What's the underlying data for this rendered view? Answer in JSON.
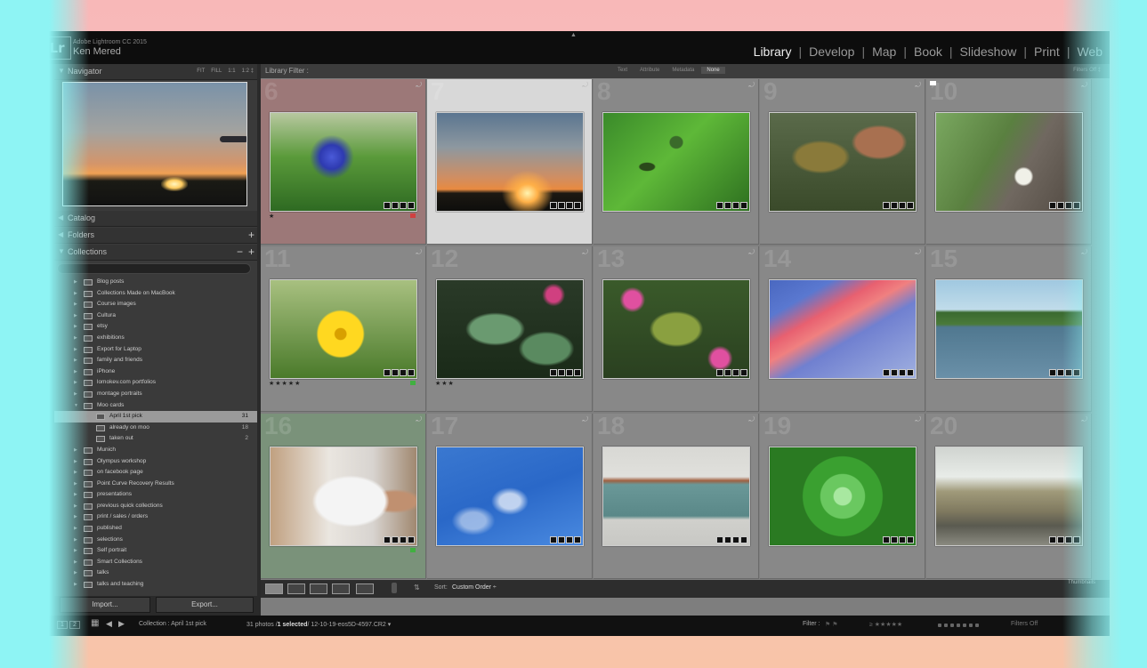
{
  "app": {
    "name": "Adobe Lightroom CC 2015",
    "user": "Ken Mered",
    "logo": "Lr"
  },
  "modules": [
    "Library",
    "Develop",
    "Map",
    "Book",
    "Slideshow",
    "Print",
    "Web"
  ],
  "active_module": "Library",
  "left_panel": {
    "navigator": {
      "title": "Navigator",
      "zooms": [
        "FIT",
        "FILL",
        "1:1",
        "1:2 ‡"
      ]
    },
    "catalog": "Catalog",
    "folders": "Folders",
    "collections_title": "Collections",
    "collections": [
      {
        "name": "Blog posts",
        "count": ""
      },
      {
        "name": "Collections Made on MacBook",
        "count": ""
      },
      {
        "name": "Course images",
        "count": ""
      },
      {
        "name": "Cultura",
        "count": ""
      },
      {
        "name": "etsy",
        "count": ""
      },
      {
        "name": "exhibitions",
        "count": ""
      },
      {
        "name": "Export for Laptop",
        "count": ""
      },
      {
        "name": "family and friends",
        "count": ""
      },
      {
        "name": "iPhone",
        "count": ""
      },
      {
        "name": "lomokev.com portfolios",
        "count": ""
      },
      {
        "name": "montage portraits",
        "count": ""
      },
      {
        "name": "Moo cards",
        "count": ""
      },
      {
        "name": "April 1st pick",
        "count": "31"
      },
      {
        "name": "already on moo",
        "count": "18"
      },
      {
        "name": "taken out",
        "count": "2"
      },
      {
        "name": "Munich",
        "count": ""
      },
      {
        "name": "Olympus workshop",
        "count": ""
      },
      {
        "name": "on facebook page",
        "count": ""
      },
      {
        "name": "Point Curve Recovery Results",
        "count": ""
      },
      {
        "name": "presentations",
        "count": ""
      },
      {
        "name": "previous quick collections",
        "count": ""
      },
      {
        "name": "print / sales / orders",
        "count": ""
      },
      {
        "name": "published",
        "count": ""
      },
      {
        "name": "selections",
        "count": ""
      },
      {
        "name": "Self portrait",
        "count": ""
      },
      {
        "name": "Smart Collections",
        "count": ""
      },
      {
        "name": "talks",
        "count": ""
      },
      {
        "name": "talks and teaching",
        "count": ""
      }
    ],
    "import_label": "Import...",
    "export_label": "Export..."
  },
  "filter_bar": {
    "label": "Library Filter :",
    "tabs": [
      "Text",
      "Attribute",
      "Metadata",
      "None"
    ],
    "active": "None",
    "filters_off": "Filters Off ‡"
  },
  "grid": [
    {
      "num": "6",
      "stars": "★",
      "color_label": "#d04040",
      "bg": "#9c7878",
      "icon": "cornflower-photo"
    },
    {
      "num": "7",
      "stars": "",
      "color_label": "",
      "bg": "#d8d8d8",
      "icon": "sunset-photo"
    },
    {
      "num": "8",
      "stars": "",
      "color_label": "",
      "bg": "#888888",
      "icon": "leaf-photo"
    },
    {
      "num": "9",
      "stars": "",
      "color_label": "",
      "bg": "#888888",
      "icon": "rose-leaves-photo"
    },
    {
      "num": "10",
      "stars": "",
      "color_label": "",
      "bg": "#888888",
      "icon": "snail-photo"
    },
    {
      "num": "11",
      "stars": "★★★★★",
      "color_label": "#40b040",
      "bg": "#888888",
      "icon": "daisy-photo"
    },
    {
      "num": "12",
      "stars": "★★★",
      "color_label": "",
      "bg": "#888888",
      "icon": "wet-leaves-photo"
    },
    {
      "num": "13",
      "stars": "",
      "color_label": "",
      "bg": "#888888",
      "icon": "buds-photo"
    },
    {
      "num": "14",
      "stars": "",
      "color_label": "",
      "bg": "#888888",
      "icon": "pink-sky-photo"
    },
    {
      "num": "15",
      "stars": "",
      "color_label": "",
      "bg": "#888888",
      "icon": "lake-photo"
    },
    {
      "num": "16",
      "stars": "",
      "color_label": "#40b040",
      "bg": "#7a927a",
      "icon": "pregnancy-photo"
    },
    {
      "num": "17",
      "stars": "",
      "color_label": "",
      "bg": "#888888",
      "icon": "blue-sky-photo"
    },
    {
      "num": "18",
      "stars": "",
      "color_label": "",
      "bg": "#888888",
      "icon": "tin-photo"
    },
    {
      "num": "19",
      "stars": "",
      "color_label": "",
      "bg": "#888888",
      "icon": "succulent-photo"
    },
    {
      "num": "20",
      "stars": "",
      "color_label": "",
      "bg": "#888888",
      "icon": "sofa-photo"
    }
  ],
  "toolbar": {
    "sort_label": "Sort:",
    "sort_value": "Custom Order ÷",
    "thumbnails": "Thumbnails"
  },
  "bottom_bar": {
    "pages": [
      "1",
      "2"
    ],
    "collection": "Collection : April 1st pick",
    "count_prefix": "31 photos /",
    "selected": "1 selected",
    "filename": "/ 12-10-19-eos5D-4597.CR2 ▾",
    "filter_label": "Filter :",
    "filters_off": "Filters Off"
  }
}
